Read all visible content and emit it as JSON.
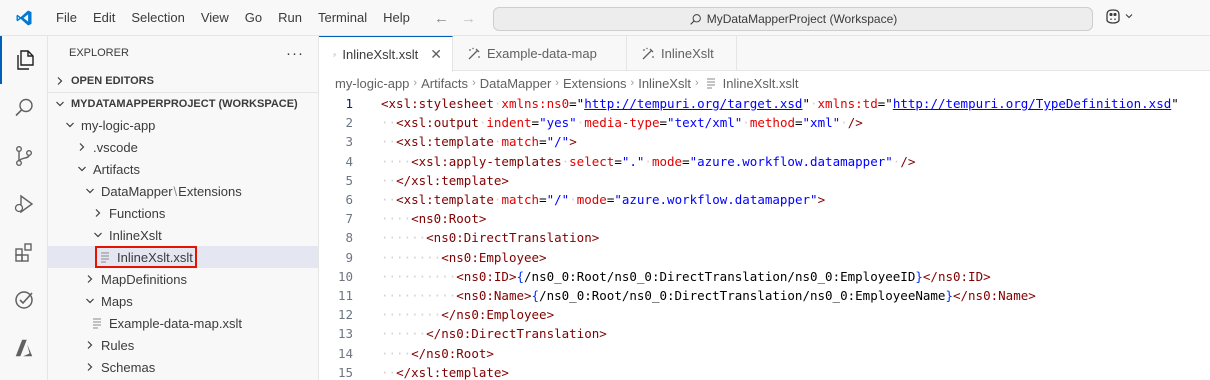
{
  "menu": [
    "File",
    "Edit",
    "Selection",
    "View",
    "Go",
    "Run",
    "Terminal",
    "Help"
  ],
  "command_center": {
    "label": "MyDataMapperProject (Workspace)"
  },
  "explorer": {
    "title": "EXPLORER",
    "open_editors": "OPEN EDITORS",
    "workspace": "MYDATAMAPPERPROJECT (WORKSPACE)",
    "tree": {
      "app": "my-logic-app",
      "vscode": ".vscode",
      "artifacts": "Artifacts",
      "datamapper": "DataMapper",
      "extensions": "Extensions",
      "functions": "Functions",
      "inlinexslt": "InlineXslt",
      "inlinexslt_file": "InlineXslt.xslt",
      "mapdefinitions": "MapDefinitions",
      "maps": "Maps",
      "example_map": "Example-data-map.xslt",
      "rules": "Rules",
      "schemas": "Schemas"
    }
  },
  "tabs": [
    {
      "label": "InlineXslt.xslt"
    },
    {
      "label": "Example-data-map"
    },
    {
      "label": "InlineXslt"
    }
  ],
  "breadcrumbs": [
    "my-logic-app",
    "Artifacts",
    "DataMapper",
    "Extensions",
    "InlineXslt",
    "InlineXslt.xslt"
  ],
  "code": {
    "line_numbers": [
      "1",
      "2",
      "3",
      "4",
      "5",
      "6",
      "7",
      "8",
      "9",
      "10",
      "11",
      "12",
      "13",
      "14",
      "15"
    ],
    "l1": {
      "open": "<xsl:stylesheet",
      "a1": "xmlns:ns0",
      "v1": "http://tempuri.org/target.xsd",
      "a2": "xmlns:td",
      "v2": "http://tempuri.org/TypeDefinition.xsd"
    },
    "l2": {
      "open": "<xsl:output",
      "a1": "indent",
      "v1": "\"yes\"",
      "a2": "media-type",
      "v2": "\"text/xml\"",
      "a3": "method",
      "v3": "\"xml\"",
      "close": "/>"
    },
    "l3": {
      "open": "<xsl:template",
      "a1": "match",
      "v1": "\"/\"",
      "close": ">"
    },
    "l4": {
      "open": "<xsl:apply-templates",
      "a1": "select",
      "v1": "\".\"",
      "a2": "mode",
      "v2": "\"azure.workflow.datamapper\"",
      "close": "/>"
    },
    "l5": {
      "tag": "</xsl:template>"
    },
    "l6": {
      "open": "<xsl:template",
      "a1": "match",
      "v1": "\"/\"",
      "a2": "mode",
      "v2": "\"azure.workflow.datamapper\"",
      "close": ">"
    },
    "l7": {
      "tag": "<ns0:Root>"
    },
    "l8": {
      "tag": "<ns0:DirectTranslation>"
    },
    "l9": {
      "tag": "<ns0:Employee>"
    },
    "l10": {
      "open": "<ns0:ID>",
      "text": "/ns0_0:Root/ns0_0:DirectTranslation/ns0_0:EmployeeID",
      "close": "</ns0:ID>"
    },
    "l11": {
      "open": "<ns0:Name>",
      "text": "/ns0_0:Root/ns0_0:DirectTranslation/ns0_0:EmployeeName",
      "close": "</ns0:Name>"
    },
    "l12": {
      "tag": "</ns0:Employee>"
    },
    "l13": {
      "tag": "</ns0:DirectTranslation>"
    },
    "l14": {
      "tag": "</ns0:Root>"
    },
    "l15": {
      "tag": "</xsl:template>"
    }
  },
  "colors": {
    "accent": "#005fb8",
    "highlight_box": "#e51400",
    "tag": "#800000",
    "attribute": "#e50000",
    "value": "#0000ff"
  },
  "icons": [
    "vscode-logo-icon",
    "explorer-icon",
    "search-icon",
    "source-control-icon",
    "run-debug-icon",
    "extensions-icon",
    "testing-icon",
    "azure-icon",
    "copilot-icon"
  ]
}
